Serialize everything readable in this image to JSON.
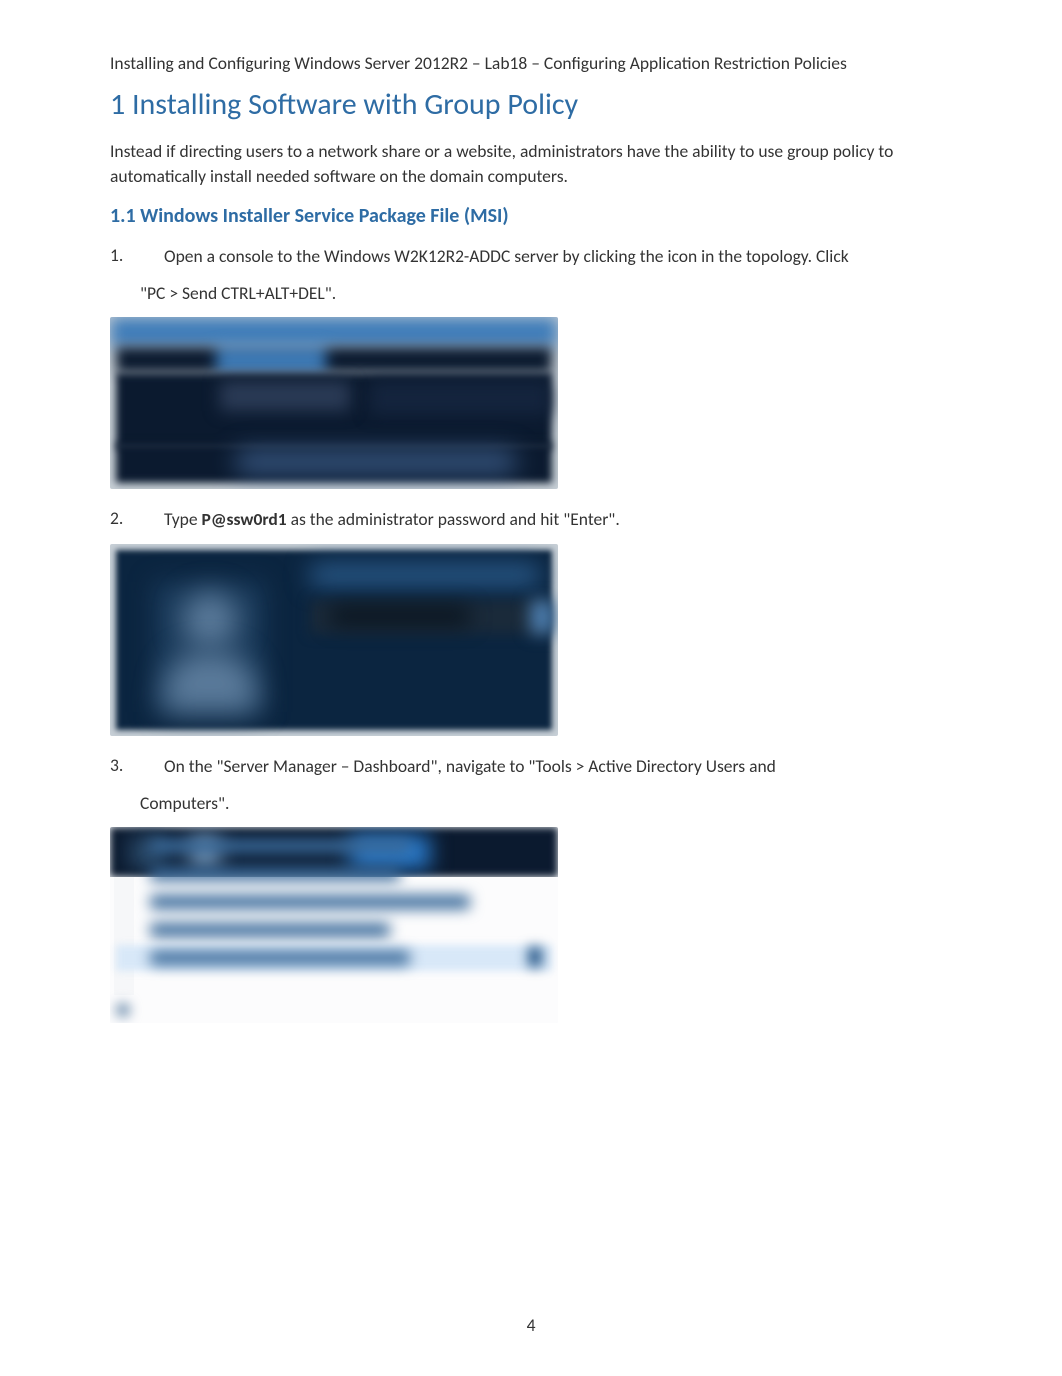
{
  "header": "Installing and Configuring Windows Server 2012R2 – Lab18 – Configuring Application Restriction Policies",
  "h1": "1 Installing Software with Group Policy",
  "intro": "Instead if directing users to a network share or a website, administrators have the ability to use group policy to automatically install needed software on the domain computers.",
  "h2": "1.1 Windows Installer Service Package File (MSI)",
  "steps": [
    {
      "num": "1.",
      "text_a": "Open a console to the Windows W2K12R2-ADDC server by clicking the icon in the topology. Click",
      "cont": "\"PC > Send CTRL+ALT+DEL\"."
    },
    {
      "num": "2.",
      "pre": "Type ",
      "bold": "P@ssw0rd1",
      "post": " as the administrator password and hit \"Enter\"."
    },
    {
      "num": "3.",
      "text_a": "On the \"Server Manager – Dashboard\", navigate to \"Tools > Active Directory Users and",
      "cont": "Computers\"."
    }
  ],
  "page_number": "4"
}
